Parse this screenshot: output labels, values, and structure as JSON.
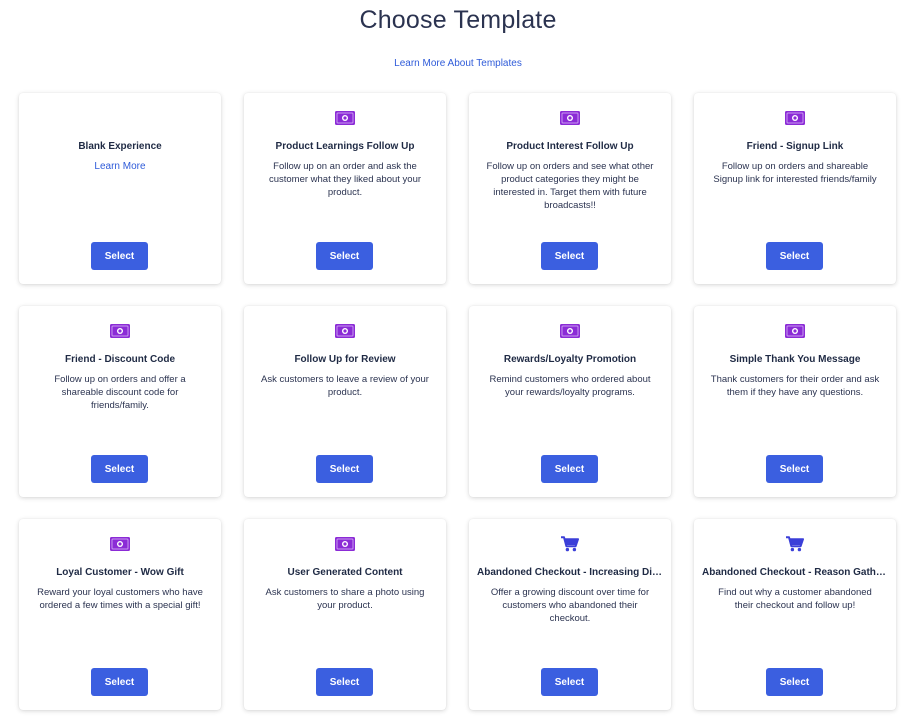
{
  "header": {
    "title": "Choose Template",
    "learn_more_templates": "Learn More About Templates"
  },
  "colors": {
    "accent": "#3b5fe0",
    "link": "#2f5bd9",
    "money_icon": "#8b2bd6",
    "cart_icon": "#3b3fd8"
  },
  "templates": [
    {
      "title": "Blank Experience",
      "description": "",
      "link": "Learn More",
      "icon": "none",
      "select_label": "Select"
    },
    {
      "title": "Product Learnings Follow Up",
      "description": "Follow up on an order and ask the customer what they liked about your product.",
      "icon": "money-icon",
      "select_label": "Select"
    },
    {
      "title": "Product Interest Follow Up",
      "description": "Follow up on orders and see what other product categories they might be interested in. Target them with future broadcasts!!",
      "icon": "money-icon",
      "select_label": "Select"
    },
    {
      "title": "Friend - Signup Link",
      "description": "Follow up on orders and shareable Signup link for interested friends/family",
      "icon": "money-icon",
      "select_label": "Select"
    },
    {
      "title": "Friend - Discount Code",
      "description": "Follow up on orders and offer a shareable discount code for friends/family.",
      "icon": "money-icon",
      "select_label": "Select"
    },
    {
      "title": "Follow Up for Review",
      "description": "Ask customers to leave a review of your product.",
      "icon": "money-icon",
      "select_label": "Select"
    },
    {
      "title": "Rewards/Loyalty Promotion",
      "description": "Remind customers who ordered about your rewards/loyalty programs.",
      "icon": "money-icon",
      "select_label": "Select"
    },
    {
      "title": "Simple Thank You Message",
      "description": "Thank customers for their order and ask them if they have any questions.",
      "icon": "money-icon",
      "select_label": "Select"
    },
    {
      "title": "Loyal Customer - Wow Gift",
      "description": "Reward your loyal customers who have ordered a few times with a special gift!",
      "icon": "money-icon",
      "select_label": "Select"
    },
    {
      "title": "User Generated Content",
      "description": "Ask customers to share a photo using your product.",
      "icon": "money-icon",
      "select_label": "Select"
    },
    {
      "title": "Abandoned Checkout - Increasing Disc...",
      "description": "Offer a growing discount over time for customers who abandoned their checkout.",
      "icon": "cart-icon",
      "select_label": "Select"
    },
    {
      "title": "Abandoned Checkout - Reason Gather...",
      "description": "Find out why a customer abandoned their checkout and follow up!",
      "icon": "cart-icon",
      "select_label": "Select"
    }
  ]
}
